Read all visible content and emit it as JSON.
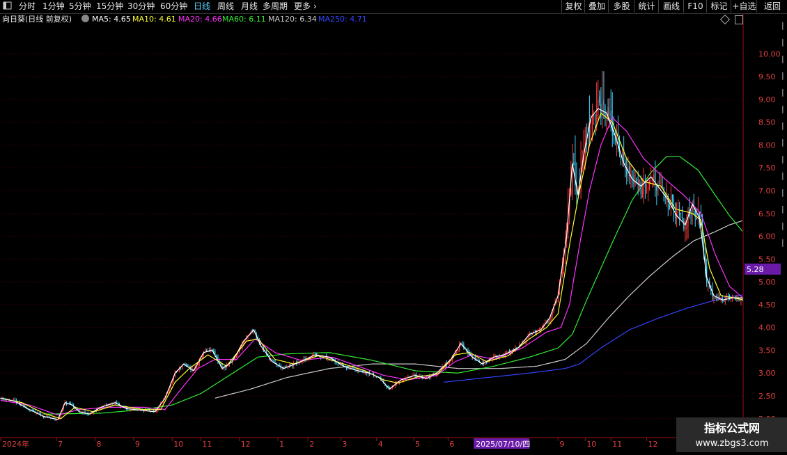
{
  "toolbar": {
    "left_items": [
      {
        "label": "分时",
        "active": false
      },
      {
        "label": "1分钟",
        "active": false
      },
      {
        "label": "5分钟",
        "active": false
      },
      {
        "label": "15分钟",
        "active": false
      },
      {
        "label": "30分钟",
        "active": false
      },
      {
        "label": "60分钟",
        "active": false
      },
      {
        "label": "日线",
        "active": true
      },
      {
        "label": "周线",
        "active": false
      },
      {
        "label": "月线",
        "active": false
      },
      {
        "label": "多周期",
        "active": false
      },
      {
        "label": "更多",
        "active": false
      }
    ],
    "right_buttons": [
      "复权",
      "叠加",
      "多股",
      "统计",
      "画线",
      "F10",
      "标记",
      "+自选",
      "返回"
    ]
  },
  "info": {
    "title": "向日葵(日线 前复权)",
    "ma": [
      {
        "label": "MA5: 4.65",
        "color": "#ffffff"
      },
      {
        "label": "MA10: 4.61",
        "color": "#ffff33"
      },
      {
        "label": "MA20: 4.66",
        "color": "#ff33ff"
      },
      {
        "label": "MA60: 6.11",
        "color": "#33ee33"
      },
      {
        "label": "MA120: 6.34",
        "color": "#cccccc"
      },
      {
        "label": "MA250: 4.71",
        "color": "#3344ff"
      }
    ]
  },
  "colors": {
    "up": "#ff3b3b",
    "down": "#3bd6ff",
    "grid": "#5a0000",
    "axis": "#9a1010",
    "price_tag_bg": "#6a1aa8"
  },
  "chart_data": {
    "type": "candlestick",
    "title": "向日葵(日线 前复权)",
    "ylim": [
      1.6,
      10.6
    ],
    "y_ticks": [
      "10.00",
      "9.50",
      "9.00",
      "8.50",
      "8.00",
      "7.50",
      "7.00",
      "6.50",
      "6.00",
      "5.50",
      "5.00",
      "4.50",
      "4.00",
      "3.50",
      "3.00",
      "2.50",
      "2.00"
    ],
    "current_price": "5.28",
    "x_labels": [
      {
        "label": "2024年",
        "i": 0
      },
      {
        "label": "7",
        "i": 40
      },
      {
        "label": "8",
        "i": 67
      },
      {
        "label": "9",
        "i": 94
      },
      {
        "label": "10",
        "i": 121
      },
      {
        "label": "11",
        "i": 141
      },
      {
        "label": "12",
        "i": 168
      },
      {
        "label": "1",
        "i": 195
      },
      {
        "label": "2",
        "i": 216
      },
      {
        "label": "3",
        "i": 239
      },
      {
        "label": "4",
        "i": 264
      },
      {
        "label": "5",
        "i": 290
      },
      {
        "label": "6",
        "i": 314
      },
      {
        "label": "7",
        "i": 339
      },
      {
        "label": "9",
        "i": 391
      },
      {
        "label": "10",
        "i": 410
      },
      {
        "label": "11",
        "i": 428
      },
      {
        "label": "12",
        "i": 453
      }
    ],
    "cursor": {
      "label": "2025/07/10/四",
      "i": 349
    },
    "n_bars": 520,
    "close_anchors": [
      [
        0,
        2.45
      ],
      [
        10,
        2.38
      ],
      [
        20,
        2.2
      ],
      [
        30,
        2.05
      ],
      [
        40,
        1.98
      ],
      [
        45,
        2.35
      ],
      [
        50,
        2.3
      ],
      [
        55,
        2.15
      ],
      [
        62,
        2.1
      ],
      [
        70,
        2.25
      ],
      [
        80,
        2.35
      ],
      [
        88,
        2.22
      ],
      [
        100,
        2.18
      ],
      [
        108,
        2.15
      ],
      [
        115,
        2.45
      ],
      [
        122,
        3.0
      ],
      [
        128,
        3.2
      ],
      [
        135,
        3.05
      ],
      [
        142,
        3.45
      ],
      [
        148,
        3.5
      ],
      [
        155,
        3.1
      ],
      [
        162,
        3.25
      ],
      [
        170,
        3.7
      ],
      [
        177,
        3.95
      ],
      [
        182,
        3.6
      ],
      [
        190,
        3.25
      ],
      [
        198,
        3.1
      ],
      [
        210,
        3.25
      ],
      [
        220,
        3.4
      ],
      [
        230,
        3.35
      ],
      [
        240,
        3.15
      ],
      [
        250,
        3.05
      ],
      [
        258,
        3.0
      ],
      [
        265,
        2.9
      ],
      [
        272,
        2.65
      ],
      [
        280,
        2.85
      ],
      [
        290,
        2.95
      ],
      [
        298,
        2.88
      ],
      [
        305,
        3.0
      ],
      [
        315,
        3.3
      ],
      [
        322,
        3.65
      ],
      [
        330,
        3.35
      ],
      [
        337,
        3.2
      ],
      [
        345,
        3.35
      ],
      [
        352,
        3.4
      ],
      [
        362,
        3.55
      ],
      [
        370,
        3.85
      ],
      [
        378,
        3.95
      ],
      [
        384,
        4.2
      ],
      [
        390,
        4.7
      ],
      [
        396,
        6.0
      ],
      [
        400,
        7.6
      ],
      [
        404,
        6.9
      ],
      [
        408,
        7.8
      ],
      [
        413,
        8.6
      ],
      [
        418,
        8.8
      ],
      [
        424,
        8.7
      ],
      [
        430,
        8.2
      ],
      [
        436,
        7.6
      ],
      [
        442,
        7.25
      ],
      [
        448,
        7.1
      ],
      [
        455,
        7.3
      ],
      [
        461,
        7.05
      ],
      [
        467,
        6.8
      ],
      [
        473,
        6.45
      ],
      [
        479,
        6.25
      ],
      [
        484,
        6.7
      ],
      [
        489,
        6.4
      ],
      [
        494,
        5.1
      ],
      [
        499,
        4.7
      ],
      [
        505,
        4.6
      ],
      [
        512,
        4.65
      ],
      [
        519,
        4.6
      ]
    ],
    "ma_anchors": {
      "MA5": [
        [
          0,
          2.45
        ],
        [
          10,
          2.38
        ],
        [
          20,
          2.2
        ],
        [
          30,
          2.05
        ],
        [
          40,
          1.98
        ],
        [
          45,
          2.35
        ],
        [
          50,
          2.3
        ],
        [
          55,
          2.15
        ],
        [
          62,
          2.1
        ],
        [
          70,
          2.25
        ],
        [
          80,
          2.35
        ],
        [
          88,
          2.22
        ],
        [
          100,
          2.18
        ],
        [
          108,
          2.15
        ],
        [
          115,
          2.45
        ],
        [
          122,
          3.0
        ],
        [
          128,
          3.2
        ],
        [
          135,
          3.05
        ],
        [
          142,
          3.45
        ],
        [
          148,
          3.5
        ],
        [
          155,
          3.1
        ],
        [
          162,
          3.25
        ],
        [
          170,
          3.7
        ],
        [
          177,
          3.95
        ],
        [
          182,
          3.6
        ],
        [
          190,
          3.25
        ],
        [
          198,
          3.1
        ],
        [
          210,
          3.25
        ],
        [
          220,
          3.4
        ],
        [
          230,
          3.35
        ],
        [
          240,
          3.15
        ],
        [
          250,
          3.05
        ],
        [
          258,
          3.0
        ],
        [
          265,
          2.9
        ],
        [
          272,
          2.65
        ],
        [
          280,
          2.85
        ],
        [
          290,
          2.95
        ],
        [
          298,
          2.88
        ],
        [
          305,
          3.0
        ],
        [
          315,
          3.3
        ],
        [
          322,
          3.65
        ],
        [
          330,
          3.35
        ],
        [
          337,
          3.2
        ],
        [
          345,
          3.35
        ],
        [
          352,
          3.4
        ],
        [
          362,
          3.55
        ],
        [
          370,
          3.85
        ],
        [
          378,
          3.95
        ],
        [
          384,
          4.2
        ],
        [
          390,
          4.7
        ],
        [
          396,
          6.0
        ],
        [
          400,
          7.6
        ],
        [
          404,
          6.9
        ],
        [
          408,
          7.8
        ],
        [
          413,
          8.6
        ],
        [
          418,
          8.8
        ],
        [
          424,
          8.7
        ],
        [
          430,
          8.2
        ],
        [
          436,
          7.6
        ],
        [
          442,
          7.25
        ],
        [
          448,
          7.1
        ],
        [
          455,
          7.3
        ],
        [
          461,
          7.05
        ],
        [
          467,
          6.8
        ],
        [
          473,
          6.45
        ],
        [
          479,
          6.25
        ],
        [
          484,
          6.7
        ],
        [
          489,
          6.4
        ],
        [
          494,
          5.1
        ],
        [
          499,
          4.7
        ],
        [
          505,
          4.6
        ],
        [
          512,
          4.65
        ],
        [
          519,
          4.65
        ]
      ],
      "MA10": [
        [
          0,
          2.45
        ],
        [
          15,
          2.35
        ],
        [
          30,
          2.12
        ],
        [
          42,
          2.0
        ],
        [
          52,
          2.25
        ],
        [
          65,
          2.15
        ],
        [
          80,
          2.3
        ],
        [
          100,
          2.2
        ],
        [
          112,
          2.2
        ],
        [
          122,
          2.8
        ],
        [
          132,
          3.1
        ],
        [
          145,
          3.4
        ],
        [
          158,
          3.15
        ],
        [
          172,
          3.7
        ],
        [
          180,
          3.75
        ],
        [
          192,
          3.3
        ],
        [
          205,
          3.2
        ],
        [
          222,
          3.38
        ],
        [
          240,
          3.2
        ],
        [
          255,
          3.05
        ],
        [
          268,
          2.85
        ],
        [
          278,
          2.78
        ],
        [
          292,
          2.92
        ],
        [
          306,
          2.98
        ],
        [
          318,
          3.4
        ],
        [
          328,
          3.45
        ],
        [
          340,
          3.25
        ],
        [
          355,
          3.38
        ],
        [
          370,
          3.75
        ],
        [
          382,
          4.0
        ],
        [
          390,
          4.3
        ],
        [
          398,
          5.8
        ],
        [
          405,
          7.0
        ],
        [
          412,
          8.0
        ],
        [
          420,
          8.7
        ],
        [
          428,
          8.5
        ],
        [
          438,
          7.7
        ],
        [
          450,
          7.2
        ],
        [
          462,
          7.1
        ],
        [
          472,
          6.6
        ],
        [
          484,
          6.5
        ],
        [
          490,
          6.35
        ],
        [
          496,
          5.3
        ],
        [
          504,
          4.7
        ],
        [
          519,
          4.61
        ]
      ],
      "MA20": [
        [
          0,
          2.4
        ],
        [
          20,
          2.3
        ],
        [
          40,
          2.08
        ],
        [
          55,
          2.2
        ],
        [
          75,
          2.25
        ],
        [
          100,
          2.25
        ],
        [
          115,
          2.2
        ],
        [
          125,
          2.6
        ],
        [
          138,
          3.1
        ],
        [
          150,
          3.3
        ],
        [
          165,
          3.3
        ],
        [
          178,
          3.75
        ],
        [
          192,
          3.45
        ],
        [
          210,
          3.28
        ],
        [
          232,
          3.35
        ],
        [
          250,
          3.15
        ],
        [
          268,
          2.95
        ],
        [
          285,
          2.85
        ],
        [
          305,
          2.95
        ],
        [
          318,
          3.25
        ],
        [
          330,
          3.4
        ],
        [
          345,
          3.3
        ],
        [
          365,
          3.55
        ],
        [
          382,
          3.9
        ],
        [
          392,
          4.0
        ],
        [
          398,
          4.5
        ],
        [
          405,
          5.8
        ],
        [
          412,
          7.0
        ],
        [
          420,
          8.0
        ],
        [
          428,
          8.6
        ],
        [
          438,
          8.3
        ],
        [
          450,
          7.7
        ],
        [
          465,
          7.25
        ],
        [
          478,
          6.9
        ],
        [
          490,
          6.5
        ],
        [
          500,
          5.6
        ],
        [
          510,
          4.9
        ],
        [
          519,
          4.66
        ]
      ],
      "MA60": [
        [
          30,
          2.1
        ],
        [
          70,
          2.12
        ],
        [
          100,
          2.2
        ],
        [
          120,
          2.3
        ],
        [
          140,
          2.55
        ],
        [
          160,
          2.95
        ],
        [
          180,
          3.35
        ],
        [
          200,
          3.42
        ],
        [
          230,
          3.45
        ],
        [
          260,
          3.28
        ],
        [
          290,
          3.05
        ],
        [
          320,
          3.0
        ],
        [
          345,
          3.15
        ],
        [
          370,
          3.35
        ],
        [
          390,
          3.55
        ],
        [
          400,
          3.85
        ],
        [
          410,
          4.6
        ],
        [
          420,
          5.3
        ],
        [
          430,
          6.0
        ],
        [
          442,
          6.8
        ],
        [
          455,
          7.4
        ],
        [
          466,
          7.75
        ],
        [
          475,
          7.75
        ],
        [
          488,
          7.45
        ],
        [
          500,
          6.9
        ],
        [
          510,
          6.45
        ],
        [
          519,
          6.11
        ]
      ],
      "MA120": [
        [
          150,
          2.45
        ],
        [
          175,
          2.65
        ],
        [
          200,
          2.9
        ],
        [
          230,
          3.1
        ],
        [
          260,
          3.2
        ],
        [
          290,
          3.2
        ],
        [
          320,
          3.1
        ],
        [
          350,
          3.1
        ],
        [
          375,
          3.15
        ],
        [
          395,
          3.3
        ],
        [
          410,
          3.65
        ],
        [
          425,
          4.2
        ],
        [
          440,
          4.7
        ],
        [
          455,
          5.15
        ],
        [
          470,
          5.55
        ],
        [
          485,
          5.9
        ],
        [
          500,
          6.1
        ],
        [
          510,
          6.25
        ],
        [
          519,
          6.34
        ]
      ],
      "MA250": [
        [
          310,
          2.8
        ],
        [
          340,
          2.9
        ],
        [
          370,
          3.0
        ],
        [
          395,
          3.1
        ],
        [
          405,
          3.2
        ],
        [
          420,
          3.55
        ],
        [
          440,
          3.95
        ],
        [
          460,
          4.2
        ],
        [
          480,
          4.42
        ],
        [
          500,
          4.6
        ],
        [
          510,
          4.68
        ],
        [
          519,
          4.71
        ]
      ]
    }
  }
}
